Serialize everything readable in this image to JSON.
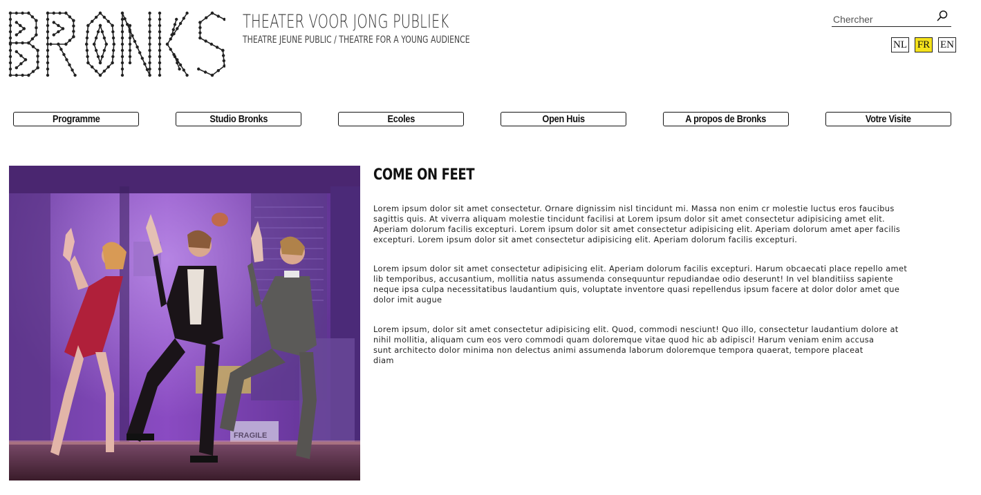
{
  "header": {
    "logo_text": "BRONKS",
    "tagline_main": "THEATER VOOR JONG PUBLIEK",
    "tagline_sub": "THEATRE JEUNE PUBLIC / THEATRE FOR A YOUNG AUDIENCE"
  },
  "search": {
    "placeholder": "Chercher",
    "icon": "search-icon"
  },
  "languages": [
    {
      "label": "NL",
      "active": false
    },
    {
      "label": "FR",
      "active": true
    },
    {
      "label": "EN",
      "active": false
    }
  ],
  "nav": [
    {
      "label": "Programme"
    },
    {
      "label": "Studio Bronks"
    },
    {
      "label": "Ecoles"
    },
    {
      "label": "Open Huis"
    },
    {
      "label": "A propos de Bronks"
    },
    {
      "label": "Votre Visite"
    }
  ],
  "article": {
    "title": "COME ON FEET",
    "paragraphs": [
      [
        "Lorem ipsum dolor sit amet consectetur. Ornare dignissim nisl tincidunt mi. Massa non enim cr molestie luctus eros faucibus",
        "sagittis quis. At viverra aliquam molestie tincidunt facilisi at Lorem ipsum dolor sit amet consectetur adipisicing amet elit.",
        "Aperiam dolorum facilis excepturi. Lorem ipsum dolor sit amet consectetur adipisicing elit. Aperiam dolorum amet aper facilis",
        "excepturi. Lorem ipsum dolor sit amet consectetur adipisicing elit. Aperiam dolorum facilis excepturi."
      ],
      [
        "Lorem ipsum dolor sit amet consectetur adipisicing elit. Aperiam dolorum facilis excepturi. Harum obcaecati place repello amet",
        "lib temporibus, accusantium, mollitia natus assumenda consequuntur repudiandae odio deserunt! In vel blanditiiss sapiente",
        "neque ipsa culpa necessitatibus laudantium quis, voluptate inventore quasi repellendus ipsum facere at dolor dolor amet que",
        "dolor imit augue"
      ],
      [
        "Lorem ipsum, dolor sit amet consectetur adipisicing elit. Quod, commodi nesciunt! Quo illo, consectetur laudantium dolore at",
        "nihil mollitia, aliquam cum eos vero commodi quam doloremque vitae quod hic ab adipisci! Harum veniam enim accusa",
        "sunt architecto dolor minima non delectus animi assumenda laborum doloremque tempora quaerat, tempore placeat",
        "diam"
      ]
    ]
  },
  "photo": {
    "scene_text": "FRAGILE"
  },
  "colors": {
    "active_lang": "#f5e21c",
    "border": "#111111"
  }
}
